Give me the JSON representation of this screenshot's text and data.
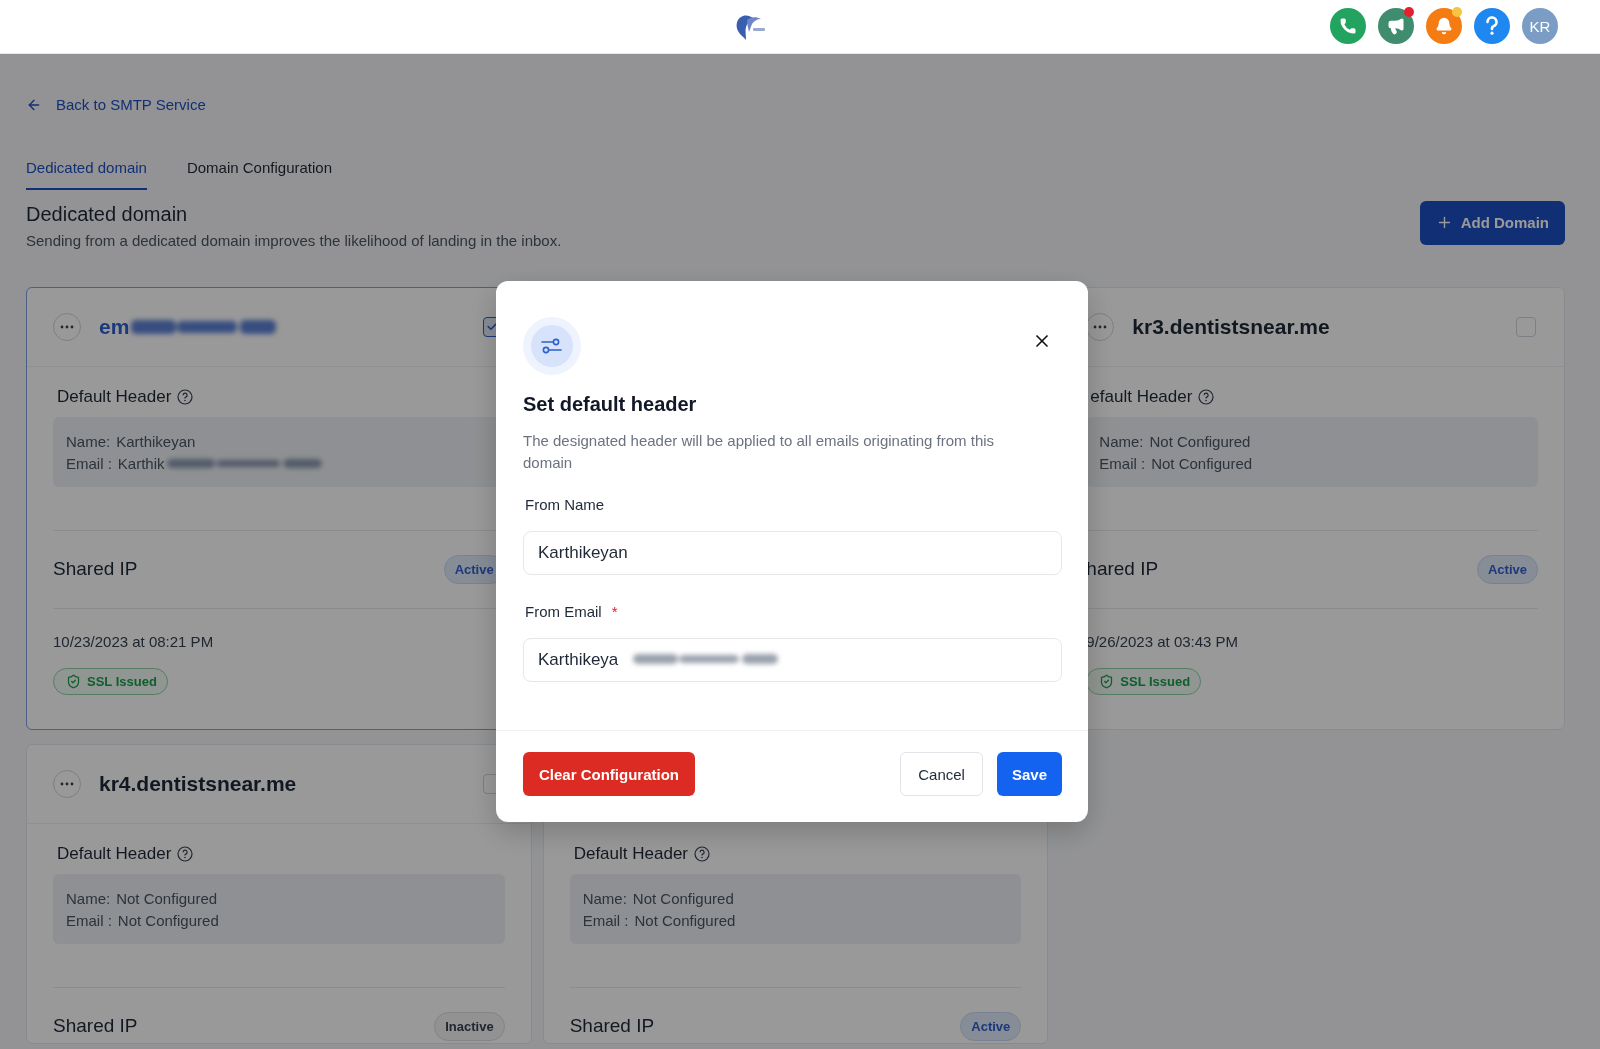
{
  "topbar": {
    "actions": [
      {
        "kind": "phone",
        "color": "#22a35f"
      },
      {
        "kind": "megaphone",
        "color": "#3f8c6e",
        "badge": {
          "color": "#e5202e"
        }
      },
      {
        "kind": "bell",
        "color": "#f57c12",
        "badge": {
          "color": "#f5c542"
        }
      },
      {
        "kind": "help",
        "color": "#1e88f0"
      }
    ],
    "avatar": "KR"
  },
  "back_link": "Back to SMTP Service",
  "tabs": [
    {
      "label": "Dedicated domain",
      "selected": true
    },
    {
      "label": "Domain Configuration",
      "selected": false
    }
  ],
  "section": {
    "title": "Dedicated domain",
    "subtitle": "Sending from a dedicated domain improves the likelihood of landing in the inbox.",
    "add_button": "Add Domain"
  },
  "cards": [
    {
      "title": "em",
      "title_redacted": true,
      "checked": true,
      "header_label": "Default Header",
      "name_label": "Name:",
      "name": "Karthikeyan",
      "email_label": "Email :",
      "email": "Karthik",
      "email_redacted": true,
      "ip_label": "Shared IP",
      "ip_status": {
        "label": "Active",
        "active": true
      },
      "date": "10/23/2023 at 08:21 PM",
      "ssl": "SSL Issued"
    },
    {
      "title": "kr3.dentistsnear.me",
      "title_redacted": false,
      "checked": false,
      "header_label": "efault Header",
      "name_label": "Name:",
      "name": "Not Configured",
      "email_label": "Email :",
      "email": "Not Configured",
      "email_redacted": false,
      "ip_label": "hared IP",
      "ip_status": {
        "label": "Active",
        "active": true
      },
      "date": "9/26/2023 at 03:43 PM",
      "ssl": "SSL Issued"
    },
    {
      "title": "kr4.dentistsnear.me",
      "title_redacted": false,
      "checked": false,
      "header_label": "Default Header",
      "name_label": "Name:",
      "name": "Not Configured",
      "email_label": "Email :",
      "email": "Not Configured",
      "email_redacted": false,
      "ip_label": "Shared IP",
      "ip_status": {
        "label": "Inactive",
        "active": false
      }
    },
    {
      "header_label": "Default Header",
      "name_label": "Name:",
      "name": "Not Configured",
      "email_label": "Email :",
      "email": "Not Configured",
      "email_redacted": false,
      "ip_label": "Shared IP",
      "ip_status": {
        "label": "Active",
        "active": true
      }
    }
  ],
  "modal": {
    "title": "Set default header",
    "description": "The designated header will be applied to all emails originating from this domain",
    "fields": [
      {
        "label": "From Name",
        "value": "Karthikeyan",
        "redacted": false
      },
      {
        "label": "From Email",
        "required_mark": "*",
        "value": "Karthikeya",
        "redacted": true
      }
    ],
    "clear_button": "Clear Configuration",
    "cancel_button": "Cancel",
    "save_button": "Save"
  }
}
